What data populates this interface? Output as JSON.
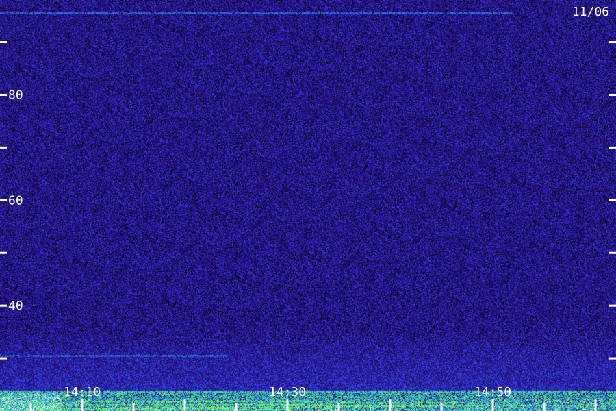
{
  "date_label": "11/06",
  "chart_data": {
    "type": "heatmap",
    "title": "",
    "xlabel": "",
    "ylabel": "",
    "x_tick_labels": [
      "14:10",
      "14:30",
      "14:50"
    ],
    "x_labeled_ticks": [
      10,
      30,
      50
    ],
    "x_minor_step": 5,
    "xlim": [
      2,
      62
    ],
    "y_tick_labels": [
      "40",
      "60",
      "80"
    ],
    "y_labeled_ticks": [
      40,
      60,
      80
    ],
    "y_tick_step": 10,
    "ylim": [
      20,
      98
    ],
    "colormap": [
      "#000000",
      "#1a0f5e",
      "#2a1aa8",
      "#3a3aff",
      "#2f8fd6",
      "#35d0c8",
      "#7dff55"
    ],
    "features": [
      {
        "kind": "band",
        "y_range": [
          20,
          24
        ],
        "intensity": "high",
        "colors": [
          "#35d0c8",
          "#7dff55",
          "#ffffff"
        ]
      },
      {
        "kind": "line",
        "y": 23.7,
        "x_range": [
          2,
          62
        ],
        "intensity": "medium"
      },
      {
        "kind": "line",
        "y": 30.5,
        "x_range": [
          2,
          24
        ],
        "intensity": "low"
      },
      {
        "kind": "line",
        "y": 95.5,
        "x_range": [
          2,
          52
        ],
        "intensity": "low"
      }
    ]
  }
}
